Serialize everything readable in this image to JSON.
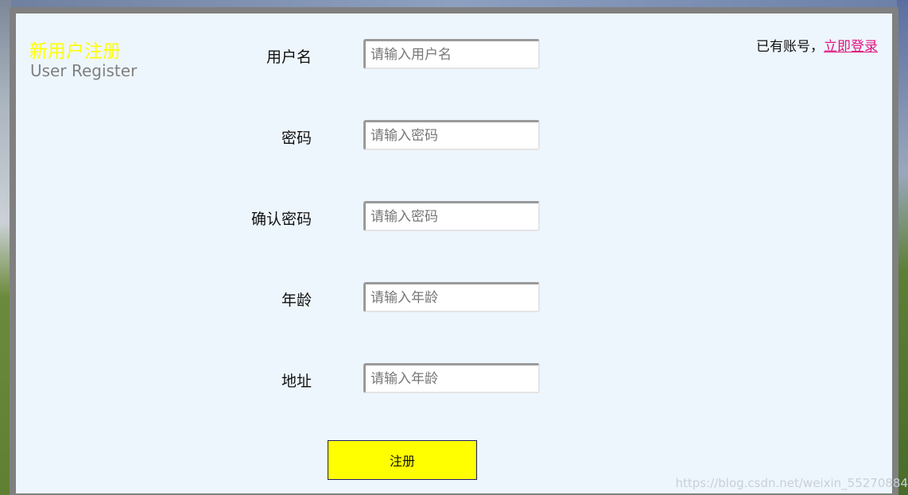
{
  "header": {
    "title_cn": "新用户注册",
    "title_en": "User Register",
    "login_prompt": "已有账号，",
    "login_link": "立即登录"
  },
  "form": {
    "fields": [
      {
        "label": "用户名",
        "placeholder": "请输入用户名",
        "value": ""
      },
      {
        "label": "密码",
        "placeholder": "请输入密码",
        "value": ""
      },
      {
        "label": "确认密码",
        "placeholder": "请输入密码",
        "value": ""
      },
      {
        "label": "年龄",
        "placeholder": "请输入年龄",
        "value": ""
      },
      {
        "label": "地址",
        "placeholder": "请输入年龄",
        "value": ""
      }
    ],
    "submit_label": "注册"
  },
  "watermark": "https://blog.csdn.net/weixin_55270884",
  "colors": {
    "title_cn": "#ffff00",
    "title_en": "#808080",
    "panel_bg": "#eef6fd",
    "panel_border": "#808080",
    "link": "#e0127f",
    "button_bg": "#ffff00"
  }
}
